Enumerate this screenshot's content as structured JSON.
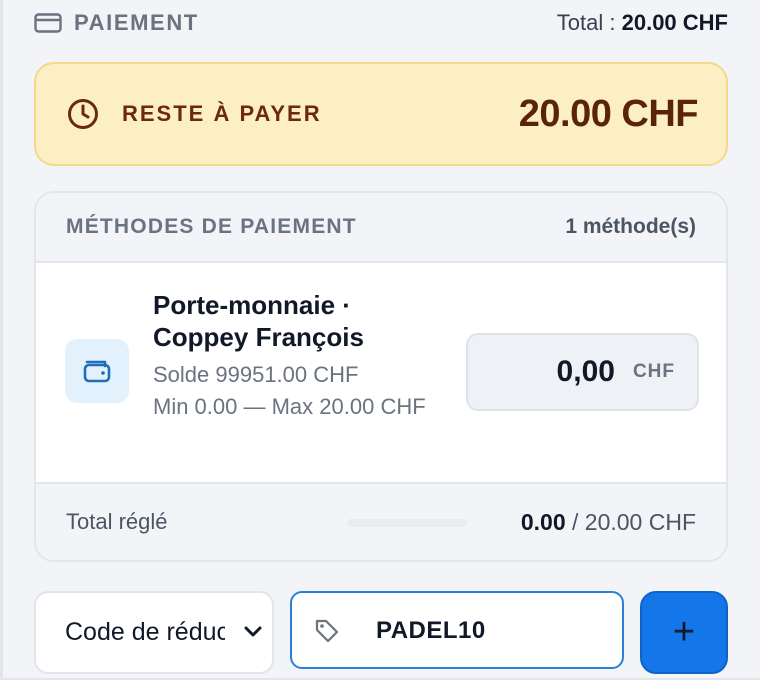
{
  "header": {
    "title": "PAIEMENT",
    "total_label": "Total :",
    "total_value": "20.00 CHF"
  },
  "remaining": {
    "label": "RESTE À PAYER",
    "amount": "20.00 CHF"
  },
  "methods": {
    "title": "MÉTHODES DE PAIEMENT",
    "count": "1 méthode(s)",
    "items": [
      {
        "icon": "wallet-icon",
        "name": "Porte-monnaie · Coppey François",
        "balance": "Solde 99951.00 CHF",
        "limits": "Min 0.00 — Max 20.00 CHF",
        "amount": "0,00",
        "unit": "CHF"
      }
    ],
    "footer": {
      "label": "Total réglé",
      "paid": "0.00",
      "separator_total": "/ 20.00 CHF",
      "progress": 0
    }
  },
  "reduction": {
    "select_value": "Code de réduction",
    "code_value": "PADEL10",
    "add_label": "+"
  },
  "colors": {
    "accent": "#1476e8",
    "warning_bg": "#fdefc4",
    "warning_text": "#5a240a"
  }
}
